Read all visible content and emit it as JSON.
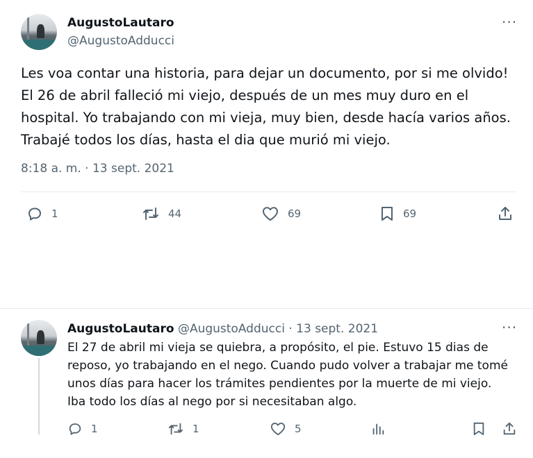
{
  "tweet": {
    "author_name": "AugustoLautaro",
    "author_handle": "@AugustoAdducci",
    "more_label": "···",
    "text": "Les voa contar una historia, para dejar un documento, por si me olvido! El 26 de abril falleció mi viejo, después de un mes muy duro en el hospital. Yo trabajando con mi vieja, muy bien, desde hacía varios años. Trabajé todos los días, hasta el dia que murió mi viejo.",
    "timestamp": "8:18 a. m. · 13 sept. 2021",
    "replies": "1",
    "reposts": "44",
    "likes": "69",
    "bookmarks": "69"
  },
  "reply": {
    "author_name": "AugustoLautaro",
    "author_handle": "@AugustoAdducci",
    "separator": "·",
    "date": "13 sept. 2021",
    "more_label": "···",
    "text": "El 27 de abril mi vieja se quiebra, a propósito, el pie. Estuvo 15 dias de reposo, yo trabajando en el nego. Cuando pudo volver a trabajar me tomé unos días para hacer los trámites pendientes por la muerte de mi viejo. Iba todo los días al nego por si necesitaban algo.",
    "replies": "1",
    "reposts": "1",
    "likes": "5"
  },
  "icons": {
    "reply": "reply-icon",
    "repost": "repost-icon",
    "like": "heart-icon",
    "bookmark": "bookmark-icon",
    "share": "share-icon",
    "views": "analytics-icon"
  },
  "colors": {
    "text_primary": "#0f1419",
    "text_secondary": "#536471",
    "divider": "#e6e9eb"
  }
}
